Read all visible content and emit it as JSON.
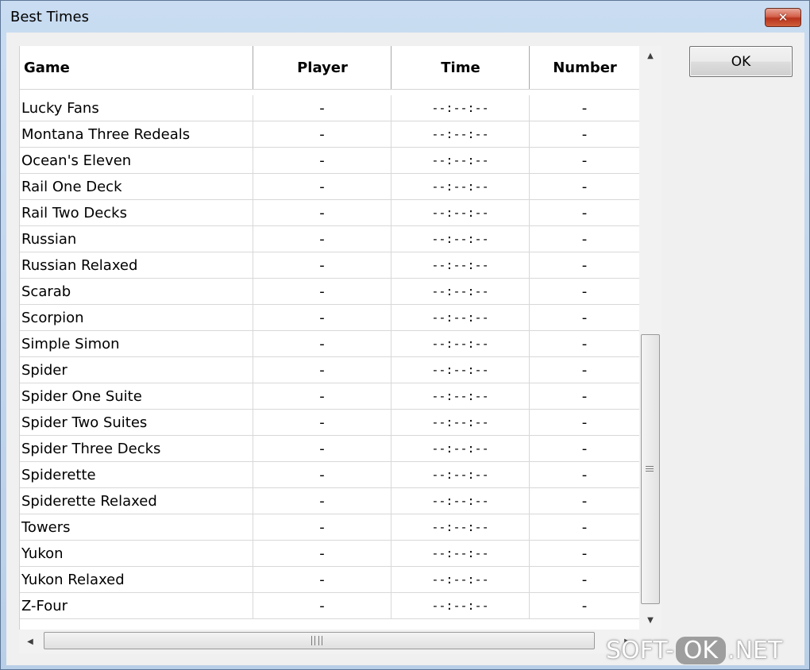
{
  "window": {
    "title": "Best Times",
    "close_label": "✕"
  },
  "ok_button": "OK",
  "columns": [
    "Game",
    "Player",
    "Time",
    "Number"
  ],
  "rows": [
    {
      "game": "Lucky Fans",
      "player": "-",
      "time": "--:--:--",
      "number": "-"
    },
    {
      "game": "Montana Three Redeals",
      "player": "-",
      "time": "--:--:--",
      "number": "-"
    },
    {
      "game": "Ocean's Eleven",
      "player": "-",
      "time": "--:--:--",
      "number": "-"
    },
    {
      "game": "Rail One Deck",
      "player": "-",
      "time": "--:--:--",
      "number": "-"
    },
    {
      "game": "Rail Two Decks",
      "player": "-",
      "time": "--:--:--",
      "number": "-"
    },
    {
      "game": "Russian",
      "player": "-",
      "time": "--:--:--",
      "number": "-"
    },
    {
      "game": "Russian Relaxed",
      "player": "-",
      "time": "--:--:--",
      "number": "-"
    },
    {
      "game": "Scarab",
      "player": "-",
      "time": "--:--:--",
      "number": "-"
    },
    {
      "game": "Scorpion",
      "player": "-",
      "time": "--:--:--",
      "number": "-"
    },
    {
      "game": "Simple Simon",
      "player": "-",
      "time": "--:--:--",
      "number": "-"
    },
    {
      "game": "Spider",
      "player": "-",
      "time": "--:--:--",
      "number": "-"
    },
    {
      "game": "Spider One Suite",
      "player": "-",
      "time": "--:--:--",
      "number": "-"
    },
    {
      "game": "Spider Two Suites",
      "player": "-",
      "time": "--:--:--",
      "number": "-"
    },
    {
      "game": "Spider Three Decks",
      "player": "-",
      "time": "--:--:--",
      "number": "-"
    },
    {
      "game": "Spiderette",
      "player": "-",
      "time": "--:--:--",
      "number": "-"
    },
    {
      "game": "Spiderette Relaxed",
      "player": "-",
      "time": "--:--:--",
      "number": "-"
    },
    {
      "game": "Towers",
      "player": "-",
      "time": "--:--:--",
      "number": "-"
    },
    {
      "game": "Yukon",
      "player": "-",
      "time": "--:--:--",
      "number": "-"
    },
    {
      "game": "Yukon Relaxed",
      "player": "-",
      "time": "--:--:--",
      "number": "-"
    },
    {
      "game": "Z-Four",
      "player": "-",
      "time": "--:--:--",
      "number": "-"
    }
  ],
  "scrollbar": {
    "up_arrow": "▲",
    "down_arrow": "▼",
    "left_arrow": "◀",
    "right_arrow": "▶"
  },
  "watermark": {
    "left": "SOFT-",
    "middle": "OK",
    "right": ".NET"
  }
}
